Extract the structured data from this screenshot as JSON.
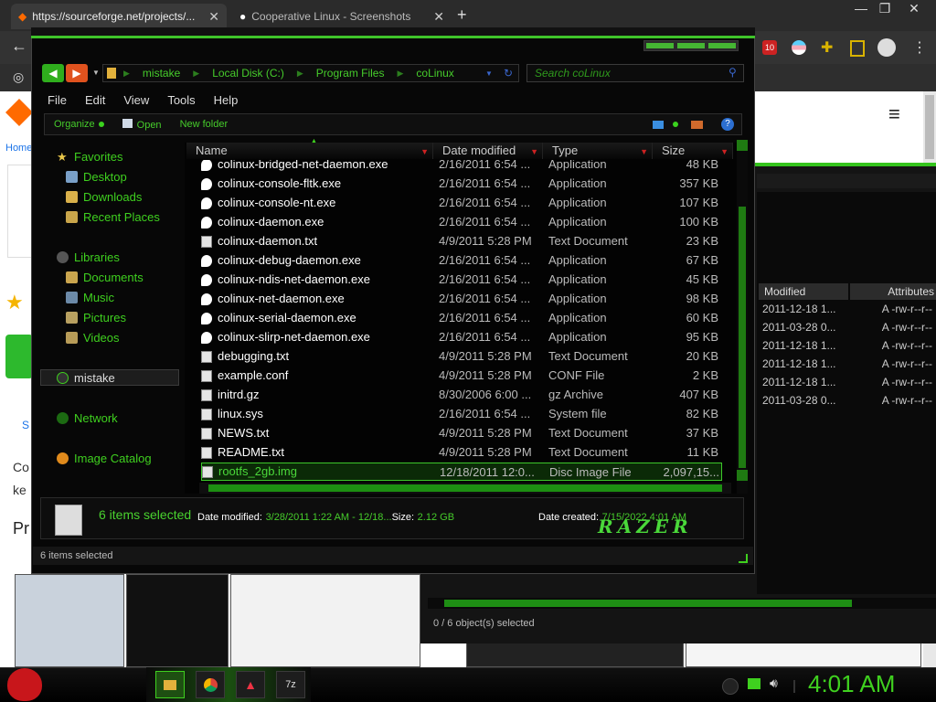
{
  "browser": {
    "tabs": [
      {
        "label": "https://sourceforge.net/projects/..."
      },
      {
        "label": "Cooperative Linux - Screenshots"
      }
    ],
    "new_tab": "+",
    "window_controls": [
      "—",
      "❐",
      "✕"
    ],
    "page_left_text": {
      "home": "Home",
      "co": "Co",
      "ke": "ke",
      "pr": "Pr",
      "s": "S"
    },
    "ext_badge": "10"
  },
  "background_window": {
    "columns": [
      "Modified",
      "Attributes"
    ],
    "rows": [
      {
        "modified": "2011-12-18 1...",
        "attrs": "A -rw-r--r--"
      },
      {
        "modified": "2011-03-28 0...",
        "attrs": "A -rw-r--r--"
      },
      {
        "modified": "2011-12-18 1...",
        "attrs": "A -rw-r--r--"
      },
      {
        "modified": "2011-12-18 1...",
        "attrs": "A -rw-r--r--"
      },
      {
        "modified": "2011-12-18 1...",
        "attrs": "A -rw-r--r--"
      },
      {
        "modified": "2011-03-28 0...",
        "attrs": "A -rw-r--r--"
      }
    ],
    "status": "0 / 6 object(s) selected"
  },
  "explorer": {
    "breadcrumb": [
      "mistake",
      "Local Disk (C:)",
      "Program Files",
      "coLinux"
    ],
    "search_placeholder": "Search coLinux",
    "menu": [
      "File",
      "Edit",
      "View",
      "Tools",
      "Help"
    ],
    "commands": {
      "organize": "Organize",
      "open": "Open",
      "new_folder": "New folder"
    },
    "nav": {
      "favorites": "Favorites",
      "desktop": "Desktop",
      "downloads": "Downloads",
      "recent": "Recent Places",
      "libraries": "Libraries",
      "documents": "Documents",
      "music": "Music",
      "pictures": "Pictures",
      "videos": "Videos",
      "mistake": "mistake",
      "network": "Network",
      "image_catalog": "Image Catalog"
    },
    "columns": {
      "name": "Name",
      "date": "Date modified",
      "type": "Type",
      "size": "Size"
    },
    "files": [
      {
        "name": "colinux-bridged-net-daemon.exe",
        "date": "2/16/2011 6:54 ...",
        "type": "Application",
        "size": "48 KB",
        "icon": "exe"
      },
      {
        "name": "colinux-console-fltk.exe",
        "date": "2/16/2011 6:54 ...",
        "type": "Application",
        "size": "357 KB",
        "icon": "exe"
      },
      {
        "name": "colinux-console-nt.exe",
        "date": "2/16/2011 6:54 ...",
        "type": "Application",
        "size": "107 KB",
        "icon": "exe"
      },
      {
        "name": "colinux-daemon.exe",
        "date": "2/16/2011 6:54 ...",
        "type": "Application",
        "size": "100 KB",
        "icon": "exe"
      },
      {
        "name": "colinux-daemon.txt",
        "date": "4/9/2011 5:28 PM",
        "type": "Text Document",
        "size": "23 KB",
        "icon": "txt"
      },
      {
        "name": "colinux-debug-daemon.exe",
        "date": "2/16/2011 6:54 ...",
        "type": "Application",
        "size": "67 KB",
        "icon": "exe"
      },
      {
        "name": "colinux-ndis-net-daemon.exe",
        "date": "2/16/2011 6:54 ...",
        "type": "Application",
        "size": "45 KB",
        "icon": "exe"
      },
      {
        "name": "colinux-net-daemon.exe",
        "date": "2/16/2011 6:54 ...",
        "type": "Application",
        "size": "98 KB",
        "icon": "exe"
      },
      {
        "name": "colinux-serial-daemon.exe",
        "date": "2/16/2011 6:54 ...",
        "type": "Application",
        "size": "60 KB",
        "icon": "exe"
      },
      {
        "name": "colinux-slirp-net-daemon.exe",
        "date": "2/16/2011 6:54 ...",
        "type": "Application",
        "size": "95 KB",
        "icon": "exe"
      },
      {
        "name": "debugging.txt",
        "date": "4/9/2011 5:28 PM",
        "type": "Text Document",
        "size": "20 KB",
        "icon": "txt"
      },
      {
        "name": "example.conf",
        "date": "4/9/2011 5:28 PM",
        "type": "CONF File",
        "size": "2 KB",
        "icon": "txt"
      },
      {
        "name": "initrd.gz",
        "date": "8/30/2006 6:00 ...",
        "type": "gz Archive",
        "size": "407 KB",
        "icon": "txt"
      },
      {
        "name": "linux.sys",
        "date": "2/16/2011 6:54 ...",
        "type": "System file",
        "size": "82 KB",
        "icon": "txt"
      },
      {
        "name": "NEWS.txt",
        "date": "4/9/2011 5:28 PM",
        "type": "Text Document",
        "size": "37 KB",
        "icon": "txt"
      },
      {
        "name": "README.txt",
        "date": "4/9/2011 5:28 PM",
        "type": "Text Document",
        "size": "11 KB",
        "icon": "txt"
      },
      {
        "name": "rootfs_2gb.img",
        "date": "12/18/2011 12:0...",
        "type": "Disc Image File",
        "size": "2,097,15...",
        "icon": "txt"
      }
    ],
    "details": {
      "count": "6 items selected",
      "date_modified_label": "Date modified:",
      "date_modified_value": "3/28/2011 1:22 AM - 12/18...",
      "size_label": "Size:",
      "size_value": "2.12 GB",
      "date_created_label": "Date created:",
      "date_created_value": "7/15/2022 4:01 AM",
      "brand": "RAZER"
    },
    "status": "6 items selected"
  },
  "taskbar": {
    "clock": "4:01 AM",
    "apps": [
      "folder",
      "chrome",
      "paint",
      "7z"
    ],
    "app_7z": "7z"
  },
  "colors": {
    "accent": "#3fd01f",
    "background": "#070707",
    "selection": "#0b2a07"
  }
}
